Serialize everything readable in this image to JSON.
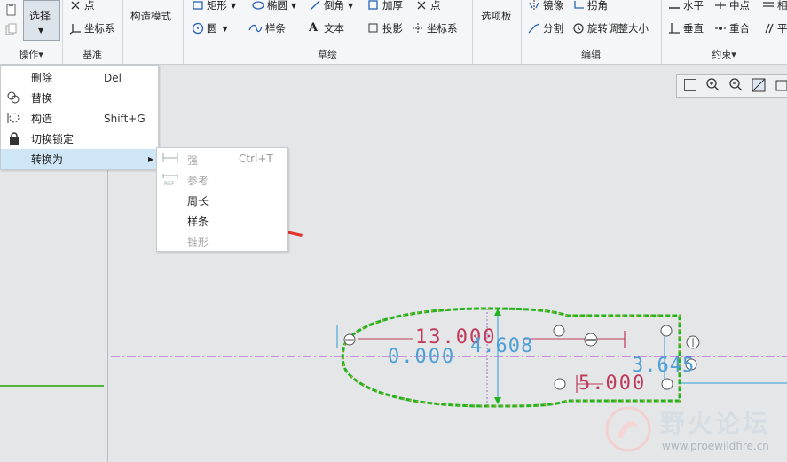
{
  "ribbon": {
    "operations": {
      "select_label": "选择",
      "group_label": "操作▾"
    },
    "datum": {
      "point_label": "点",
      "csys_label": "坐标系",
      "group_label": "基准"
    },
    "construction_mode_label": "构造模式",
    "sketch": {
      "rectangle_label": "矩形",
      "ellipse_label": "椭圆",
      "chamfer_label": "倒角",
      "thicken_label": "加厚",
      "point_label": "点",
      "circle_label": "圆",
      "spline_label": "样条",
      "text_label": "文本",
      "project_label": "投影",
      "csys_label": "坐标系",
      "group_label": "草绘"
    },
    "palette_label": "选项板",
    "edit": {
      "mirror_label": "镜像",
      "corner_label": "拐角",
      "divide_label": "分割",
      "rotate_resize_label": "旋转调整大小",
      "group_label": "编辑"
    },
    "constrain": {
      "horizontal_label": "水平",
      "midpoint_label": "中点",
      "tangent_label": "相",
      "vertical_label": "垂直",
      "coincident_label": "重合",
      "parallel_label": "平",
      "group_label": "约束▾"
    }
  },
  "context_menu": {
    "items": [
      {
        "label": "删除",
        "shortcut": "Del"
      },
      {
        "label": "替换",
        "shortcut": ""
      },
      {
        "label": "构造",
        "shortcut": "Shift+G"
      },
      {
        "label": "切换锁定",
        "shortcut": ""
      },
      {
        "label": "转换为",
        "shortcut": ""
      }
    ]
  },
  "submenu": {
    "items": [
      {
        "label": "强",
        "shortcut": "Ctrl+T",
        "enabled": false
      },
      {
        "label": "参考",
        "shortcut": "",
        "enabled": false
      },
      {
        "label": "周长",
        "shortcut": "",
        "enabled": true
      },
      {
        "label": "样条",
        "shortcut": "",
        "enabled": true
      },
      {
        "label": "锥形",
        "shortcut": "",
        "enabled": false
      }
    ]
  },
  "sketch": {
    "dim_13": "13.000",
    "dim_0": "0.000",
    "dim_4608": "4.608",
    "dim_3645": "3.645",
    "dim_5": "5.000"
  },
  "watermark": {
    "brand": "野火论坛",
    "url": "www.proewildfire.cn"
  },
  "colors": {
    "menu_highlight": "#cfe6f7",
    "sketch_green": "#1fb41f",
    "dimension": "#c0395a",
    "centerline": "#b03ad0",
    "arrow": "#e2332b"
  }
}
